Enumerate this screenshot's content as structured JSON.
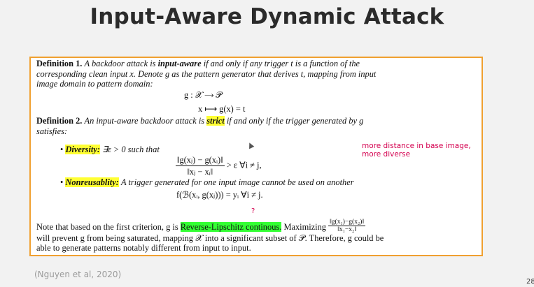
{
  "slide": {
    "title": "Input-Aware Dynamic Attack",
    "citation": "(Nguyen et al, 2020)",
    "page_number": "28"
  },
  "def1": {
    "label": "Definition 1.",
    "text_a": "A backdoor attack is",
    "term": "input-aware",
    "text_b": "if and only if any trigger t is a function of the",
    "line2": "corresponding clean input x. Denote g as the pattern generator that derives t, mapping from input",
    "line3": "image domain to pattern domain:",
    "eq1": "g : 𝒳 ⟶ 𝒫",
    "eq2": "x ⟼ g(x) = t"
  },
  "def2": {
    "label": "Definition 2.",
    "text_a": "An input-aware backdoor attack is",
    "term": "strict",
    "text_b": "if and only if the trigger generated by g",
    "line2": "satisfies:"
  },
  "diversity": {
    "label": "Diversity:",
    "text": "∃ε > 0 such that",
    "frac_num": "‖g(xⱼ) − g(xᵢ)‖",
    "frac_den": "‖xⱼ − xᵢ‖",
    "rhs": "> ε        ∀i ≠ j,"
  },
  "nonreusability": {
    "label": "Nonreusablity:",
    "text": "A trigger generated for one input image cannot be used on another",
    "eq": "f(ℬ(xᵢ, g(xⱼ))) = yᵢ        ∀i ≠ j."
  },
  "closing": {
    "text_a": "Note that based on the first criterion, g is",
    "highlight": "Reverse-Lipschitz continous.",
    "text_b": "Maximizing",
    "frac_num": "‖g(x₁)−g(x₂)‖",
    "frac_den": "‖x₁−x₂‖",
    "line2": "will prevent g from being saturated, mapping 𝒳 into a significant subset of 𝒫. Therefore, g could be",
    "line3": "able to generate patterns notably different from input to input."
  },
  "annotations": {
    "note_line1": "more distance in base image,",
    "note_line2": "more diverse",
    "question_mark": "?"
  },
  "colors": {
    "box_border": "#f0a030",
    "highlight_yellow": "#ffff33",
    "highlight_green": "#33ff33",
    "annotation": "#d4004f"
  }
}
